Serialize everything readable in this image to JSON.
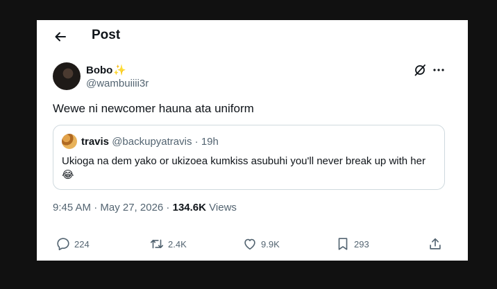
{
  "header": {
    "title": "Post"
  },
  "post": {
    "author_name": "Bobo",
    "author_emoji": "✨",
    "author_handle": "@wambuiiii3r",
    "text": "Wewe ni newcomer hauna ata uniform",
    "timestamp": "9:45 AM · May 27, 2026",
    "separator": " · ",
    "views_count": "134.6K",
    "views_label": "Views"
  },
  "quote": {
    "author_name": "travis",
    "author_handle": "@backupyatravis",
    "separator": " · ",
    "time": "19h",
    "text": "Ukioga na dem yako or ukizoea kumkiss asubuhi you'll never break up with her 😂"
  },
  "actions": {
    "replies": "224",
    "reposts": "2.4K",
    "likes": "9.9K",
    "bookmarks": "293"
  },
  "icons": {
    "back": "back-arrow-icon",
    "grok": "grok-icon",
    "more": "more-icon",
    "reply": "reply-icon",
    "repost": "repost-icon",
    "like": "heart-icon",
    "bookmark": "bookmark-icon",
    "share": "share-icon"
  },
  "colors": {
    "text": "#0f1419",
    "secondary": "#536471",
    "border": "#cfd9de",
    "sparkle": "#f5b400"
  }
}
